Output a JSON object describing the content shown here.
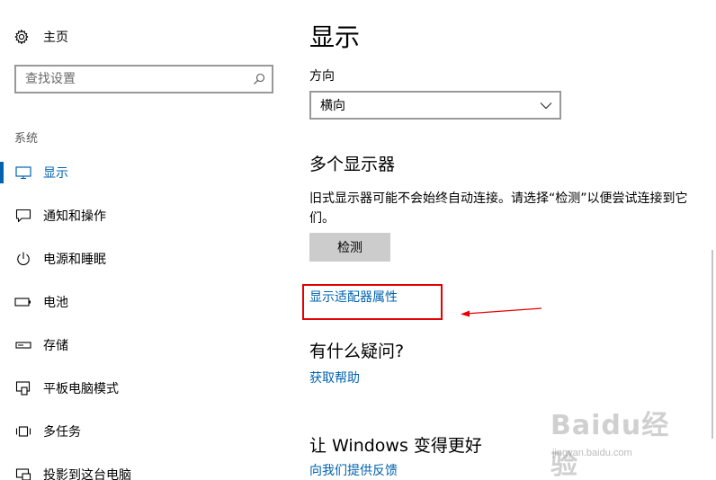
{
  "sidebar": {
    "home_label": "主页",
    "search_placeholder": "查找设置",
    "section_label": "系统",
    "items": [
      {
        "label": "显示",
        "icon": "monitor-icon",
        "active": true
      },
      {
        "label": "通知和操作",
        "icon": "message-icon",
        "active": false
      },
      {
        "label": "电源和睡眠",
        "icon": "power-icon",
        "active": false
      },
      {
        "label": "电池",
        "icon": "battery-icon",
        "active": false
      },
      {
        "label": "存储",
        "icon": "storage-icon",
        "active": false
      },
      {
        "label": "平板电脑模式",
        "icon": "tablet-mode-icon",
        "active": false
      },
      {
        "label": "多任务",
        "icon": "multitask-icon",
        "active": false
      },
      {
        "label": "投影到这台电脑",
        "icon": "project-icon",
        "active": false
      }
    ]
  },
  "main": {
    "title": "显示",
    "orientation_label": "方向",
    "orientation_value": "横向",
    "multi_display_title": "多个显示器",
    "multi_display_desc": "旧式显示器可能不会始终自动连接。请选择“检测”以便尝试连接到它们。",
    "detect_button": "检测",
    "adapter_link": "显示适配器属性",
    "question_title": "有什么疑问?",
    "help_link": "获取帮助",
    "better_title": "让 Windows 变得更好",
    "feedback_link": "向我们提供反馈"
  },
  "watermark": {
    "brand": "Baidu经验",
    "url": "jingyan.baidu.com"
  },
  "colors": {
    "accent": "#0063b1",
    "annotation": "#e60000",
    "button_bg": "#cccccc"
  }
}
